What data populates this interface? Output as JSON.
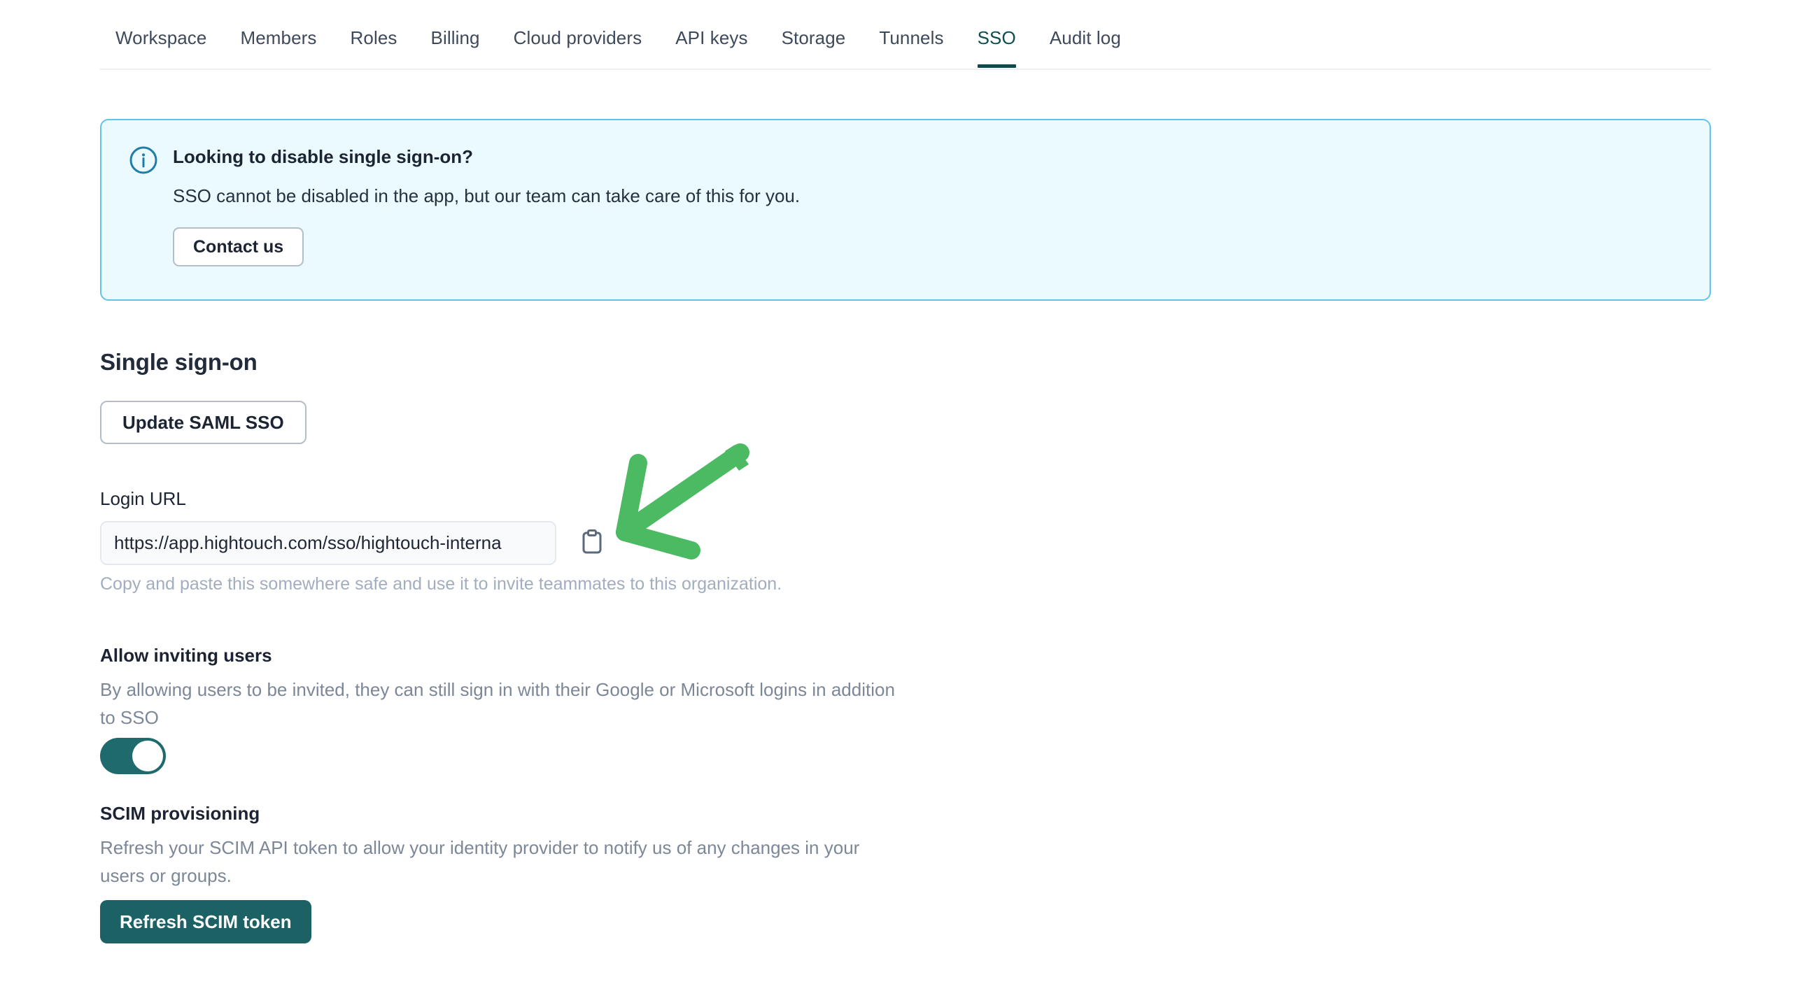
{
  "tabs": [
    {
      "label": "Workspace",
      "active": false
    },
    {
      "label": "Members",
      "active": false
    },
    {
      "label": "Roles",
      "active": false
    },
    {
      "label": "Billing",
      "active": false
    },
    {
      "label": "Cloud providers",
      "active": false
    },
    {
      "label": "API keys",
      "active": false
    },
    {
      "label": "Storage",
      "active": false
    },
    {
      "label": "Tunnels",
      "active": false
    },
    {
      "label": "SSO",
      "active": true
    },
    {
      "label": "Audit log",
      "active": false
    }
  ],
  "banner": {
    "icon": "info-circle-icon",
    "title": "Looking to disable single sign-on?",
    "text": "SSO cannot be disabled in the app, but our team can take care of this for you.",
    "button_label": "Contact us",
    "background_color": "#eafaff",
    "border_color": "#62c3ea",
    "icon_color": "#1f7ea8"
  },
  "sso_section": {
    "heading": "Single sign-on",
    "update_button_label": "Update SAML SSO",
    "login_url": {
      "label": "Login URL",
      "value": "https://app.hightouch.com/sso/hightouch-interna",
      "placeholder": "https://app.hightouch.com/sso/",
      "copy_icon": "clipboard-icon",
      "helper_text": "Copy and paste this somewhere safe and use it to invite teammates to this organization."
    }
  },
  "allow_inviting": {
    "heading": "Allow inviting users",
    "description": "By allowing users to be invited, they can still sign in with their Google or Microsoft logins in addition to SSO",
    "toggle_state": "on",
    "toggle_color": "#1e6a6d"
  },
  "scim": {
    "heading": "SCIM provisioning",
    "description": "Refresh your SCIM API token to allow your identity provider to notify us of any changes in your users or groups.",
    "button_label": "Refresh SCIM token",
    "button_color": "#1c6264"
  },
  "annotation": {
    "type": "arrow",
    "color": "#4cb963",
    "points_to": "clipboard-copy-button",
    "direction": "down-left"
  }
}
